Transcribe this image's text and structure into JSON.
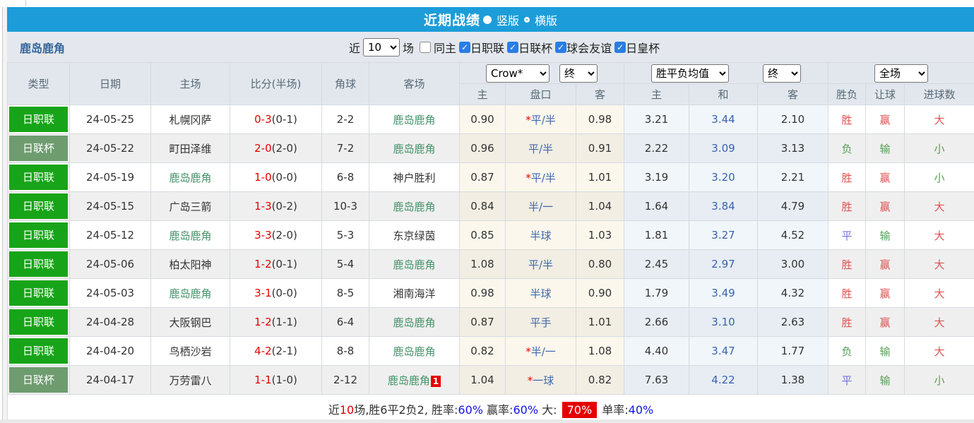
{
  "title_bar": {
    "title": "近期战绩",
    "vertical": "竖版",
    "horizontal": "横版"
  },
  "filter_bar": {
    "team": "鹿岛鹿角",
    "near": "近",
    "count": "10",
    "matches": "场",
    "same_home": "同主",
    "leagues": [
      "日职联",
      "日联杯",
      "球会友谊",
      "日皇杯"
    ]
  },
  "table": {
    "headers": {
      "type": "类型",
      "date": "日期",
      "home": "主场",
      "score": "比分(半场)",
      "corner": "角球",
      "away": "客场"
    },
    "dropdowns": {
      "company": "Crow*",
      "time1": "终",
      "europe": "胜平负均值",
      "time2": "终",
      "scope": "全场"
    },
    "sub_headers": [
      "主",
      "盘口",
      "客",
      "主",
      "和",
      "客",
      "胜负",
      "让球",
      "进球数"
    ],
    "rows": [
      {
        "league": "日职联",
        "league_style": "bright",
        "date": "24-05-25",
        "home": "札幌冈萨",
        "home_is_focus": false,
        "score": "0-3",
        "half": "(0-1)",
        "corner": "2-2",
        "away": "鹿岛鹿角",
        "away_is_focus": true,
        "away_sup": "",
        "ah_home": "0.90",
        "ah_star": true,
        "ah_line": "平/半",
        "ah_away": "0.98",
        "eu_home": "3.21",
        "eu_draw": "3.44",
        "eu_away": "2.10",
        "res": [
          "胜",
          "red"
        ],
        "hcp_res": [
          "赢",
          "red"
        ],
        "goal_res": [
          "大",
          "red"
        ]
      },
      {
        "league": "日联杯",
        "league_style": "muted",
        "date": "24-05-22",
        "home": "町田泽维",
        "home_is_focus": false,
        "score": "2-0",
        "half": "(2-0)",
        "corner": "7-2",
        "away": "鹿岛鹿角",
        "away_is_focus": true,
        "away_sup": "",
        "ah_home": "0.96",
        "ah_star": false,
        "ah_line": "平/半",
        "ah_away": "0.91",
        "eu_home": "2.22",
        "eu_draw": "3.09",
        "eu_away": "3.13",
        "res": [
          "负",
          "green"
        ],
        "hcp_res": [
          "输",
          "green"
        ],
        "goal_res": [
          "小",
          "green"
        ]
      },
      {
        "league": "日职联",
        "league_style": "bright",
        "date": "24-05-19",
        "home": "鹿岛鹿角",
        "home_is_focus": true,
        "score": "1-0",
        "half": "(0-0)",
        "corner": "6-8",
        "away": "神户胜利",
        "away_is_focus": false,
        "away_sup": "",
        "ah_home": "0.87",
        "ah_star": true,
        "ah_line": "平/半",
        "ah_away": "1.01",
        "eu_home": "3.19",
        "eu_draw": "3.20",
        "eu_away": "2.21",
        "res": [
          "胜",
          "red"
        ],
        "hcp_res": [
          "赢",
          "red"
        ],
        "goal_res": [
          "小",
          "green"
        ]
      },
      {
        "league": "日职联",
        "league_style": "bright",
        "date": "24-05-15",
        "home": "广岛三箭",
        "home_is_focus": false,
        "score": "1-3",
        "half": "(0-2)",
        "corner": "10-3",
        "away": "鹿岛鹿角",
        "away_is_focus": true,
        "away_sup": "",
        "ah_home": "0.84",
        "ah_star": false,
        "ah_line": "半/一",
        "ah_away": "1.04",
        "eu_home": "1.64",
        "eu_draw": "3.84",
        "eu_away": "4.79",
        "res": [
          "胜",
          "red"
        ],
        "hcp_res": [
          "赢",
          "red"
        ],
        "goal_res": [
          "大",
          "red"
        ]
      },
      {
        "league": "日职联",
        "league_style": "bright",
        "date": "24-05-12",
        "home": "鹿岛鹿角",
        "home_is_focus": true,
        "score": "3-3",
        "half": "(2-0)",
        "corner": "5-3",
        "away": "东京绿茵",
        "away_is_focus": false,
        "away_sup": "",
        "ah_home": "0.85",
        "ah_star": false,
        "ah_line": "半球",
        "ah_away": "1.03",
        "eu_home": "1.81",
        "eu_draw": "3.27",
        "eu_away": "4.52",
        "res": [
          "平",
          "blue"
        ],
        "hcp_res": [
          "输",
          "green"
        ],
        "goal_res": [
          "大",
          "red"
        ]
      },
      {
        "league": "日职联",
        "league_style": "bright",
        "date": "24-05-06",
        "home": "柏太阳神",
        "home_is_focus": false,
        "score": "1-2",
        "half": "(0-1)",
        "corner": "5-4",
        "away": "鹿岛鹿角",
        "away_is_focus": true,
        "away_sup": "",
        "ah_home": "1.08",
        "ah_star": false,
        "ah_line": "平/半",
        "ah_away": "0.80",
        "eu_home": "2.45",
        "eu_draw": "2.97",
        "eu_away": "3.00",
        "res": [
          "胜",
          "red"
        ],
        "hcp_res": [
          "赢",
          "red"
        ],
        "goal_res": [
          "大",
          "red"
        ]
      },
      {
        "league": "日职联",
        "league_style": "bright",
        "date": "24-05-03",
        "home": "鹿岛鹿角",
        "home_is_focus": true,
        "score": "3-1",
        "half": "(0-0)",
        "corner": "8-5",
        "away": "湘南海洋",
        "away_is_focus": false,
        "away_sup": "",
        "ah_home": "0.98",
        "ah_star": false,
        "ah_line": "半球",
        "ah_away": "0.90",
        "eu_home": "1.79",
        "eu_draw": "3.49",
        "eu_away": "4.32",
        "res": [
          "胜",
          "red"
        ],
        "hcp_res": [
          "赢",
          "red"
        ],
        "goal_res": [
          "大",
          "red"
        ]
      },
      {
        "league": "日职联",
        "league_style": "bright",
        "date": "24-04-28",
        "home": "大阪钢巴",
        "home_is_focus": false,
        "score": "1-2",
        "half": "(1-1)",
        "corner": "6-4",
        "away": "鹿岛鹿角",
        "away_is_focus": true,
        "away_sup": "",
        "ah_home": "0.87",
        "ah_star": false,
        "ah_line": "平手",
        "ah_away": "1.01",
        "eu_home": "2.66",
        "eu_draw": "3.10",
        "eu_away": "2.63",
        "res": [
          "胜",
          "red"
        ],
        "hcp_res": [
          "赢",
          "red"
        ],
        "goal_res": [
          "大",
          "red"
        ]
      },
      {
        "league": "日职联",
        "league_style": "bright",
        "date": "24-04-20",
        "home": "鸟栖沙岩",
        "home_is_focus": false,
        "score": "4-2",
        "half": "(2-1)",
        "corner": "8-8",
        "away": "鹿岛鹿角",
        "away_is_focus": true,
        "away_sup": "",
        "ah_home": "0.82",
        "ah_star": true,
        "ah_line": "半/一",
        "ah_away": "1.08",
        "eu_home": "4.40",
        "eu_draw": "3.47",
        "eu_away": "1.77",
        "res": [
          "负",
          "green"
        ],
        "hcp_res": [
          "输",
          "green"
        ],
        "goal_res": [
          "大",
          "red"
        ]
      },
      {
        "league": "日联杯",
        "league_style": "muted",
        "date": "24-04-17",
        "home": "万劳雷八",
        "home_is_focus": false,
        "score": "1-1",
        "half": "(1-0)",
        "corner": "2-12",
        "away": "鹿岛鹿角",
        "away_is_focus": true,
        "away_sup": "1",
        "ah_home": "1.04",
        "ah_star": true,
        "ah_line": "一球",
        "ah_away": "0.82",
        "eu_home": "7.63",
        "eu_draw": "4.22",
        "eu_away": "1.38",
        "res": [
          "平",
          "blue"
        ],
        "hcp_res": [
          "输",
          "green"
        ],
        "goal_res": [
          "小",
          "green"
        ]
      }
    ]
  },
  "footer": {
    "parts": [
      {
        "t": "近",
        "c": "dark"
      },
      {
        "t": "10",
        "c": "red"
      },
      {
        "t": "场,胜6平2负2, 胜率:",
        "c": "dark"
      },
      {
        "t": "60%",
        "c": "blue"
      },
      {
        "t": " 赢率:",
        "c": "dark"
      },
      {
        "t": "60%",
        "c": "blue"
      },
      {
        "t": " 大: ",
        "c": "dark"
      },
      {
        "t": "70%",
        "c": "redbg"
      },
      {
        "t": " 单率:",
        "c": "dark"
      },
      {
        "t": "40%",
        "c": "blue"
      }
    ]
  },
  "colors": {
    "accent_blue": "#1C9DD9",
    "league_green": "#18A418",
    "cup_green": "#6E9C6F",
    "score_red": "#E60000",
    "team_green": "#44936A",
    "handicap_blue": "#3D68AE",
    "draw_odds_blue": "#3A62B0",
    "win_red": "#E05252",
    "lose_green": "#55A055",
    "draw_blue": "#7272D8",
    "checkbox_blue": "#2A7DE2",
    "percent_blue": "#1414E6"
  }
}
